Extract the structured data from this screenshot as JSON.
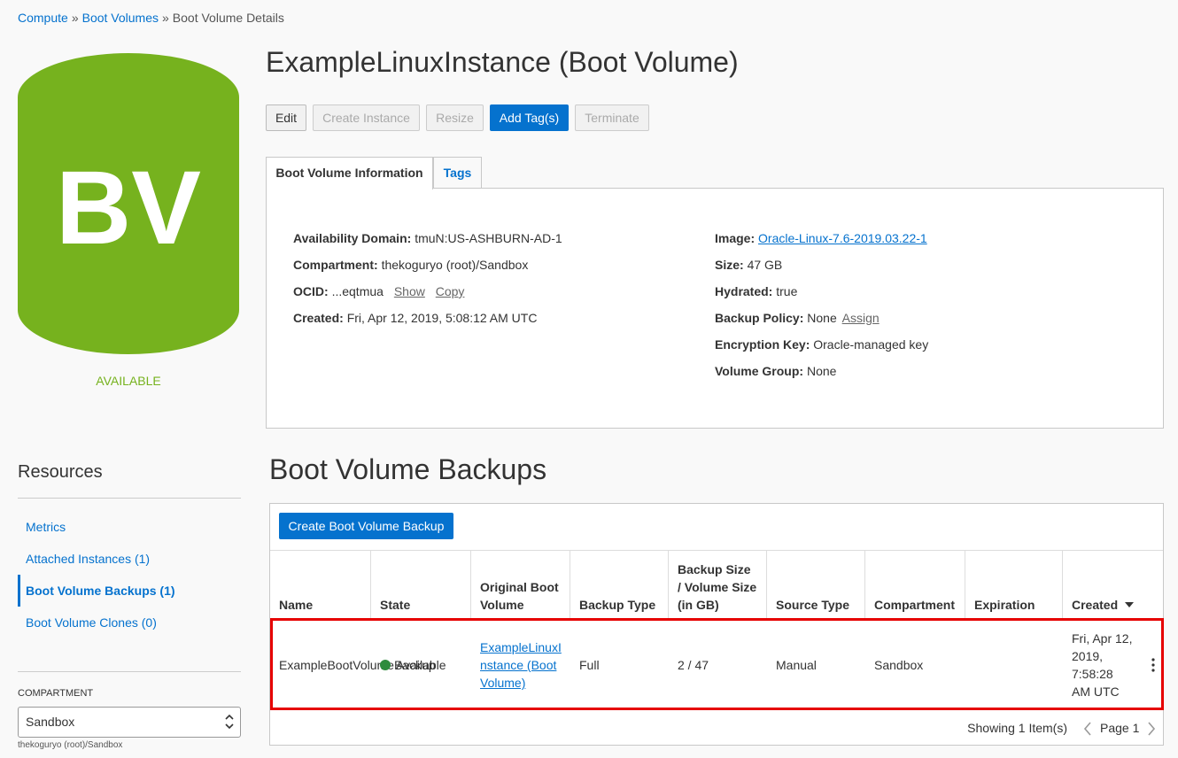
{
  "breadcrumb": {
    "compute": "Compute",
    "boot_volumes": "Boot Volumes",
    "sep": "»",
    "current": "Boot Volume Details"
  },
  "icon": {
    "letters": "BV",
    "color": "#76b21e"
  },
  "status": "AVAILABLE",
  "title": "ExampleLinuxInstance (Boot Volume)",
  "actions": {
    "edit": "Edit",
    "create_instance": "Create Instance",
    "resize": "Resize",
    "add_tags": "Add Tag(s)",
    "terminate": "Terminate"
  },
  "tabs": {
    "info": "Boot Volume Information",
    "tags": "Tags"
  },
  "info": {
    "ad_label": "Availability Domain:",
    "ad_value": "tmuN:US-ASHBURN-AD-1",
    "compartment_label": "Compartment:",
    "compartment_value": "thekoguryo (root)/Sandbox",
    "ocid_label": "OCID:",
    "ocid_value": "...eqtmua",
    "ocid_show": "Show",
    "ocid_copy": "Copy",
    "created_label": "Created:",
    "created_value": "Fri, Apr 12, 2019, 5:08:12 AM UTC",
    "image_label": "Image:",
    "image_value": "Oracle-Linux-7.6-2019.03.22-1",
    "size_label": "Size:",
    "size_value": "47 GB",
    "hydrated_label": "Hydrated:",
    "hydrated_value": "true",
    "backup_policy_label": "Backup Policy:",
    "backup_policy_value": "None",
    "backup_policy_assign": "Assign",
    "encryption_label": "Encryption Key:",
    "encryption_value": "Oracle-managed key",
    "volume_group_label": "Volume Group:",
    "volume_group_value": "None"
  },
  "resources": {
    "title": "Resources",
    "items": [
      {
        "label": "Metrics"
      },
      {
        "label": "Attached Instances (1)"
      },
      {
        "label": "Boot Volume Backups (1)"
      },
      {
        "label": "Boot Volume Clones (0)"
      }
    ],
    "compartment_label": "COMPARTMENT",
    "compartment_value": "Sandbox",
    "compartment_path": "thekoguryo (root)/Sandbox"
  },
  "backups": {
    "title": "Boot Volume Backups",
    "create_button": "Create Boot Volume Backup",
    "columns": {
      "name": "Name",
      "state": "State",
      "original": "Original Boot Volume",
      "backup_type": "Backup Type",
      "size": "Backup Size / Volume Size (in GB)",
      "source_type": "Source Type",
      "compartment": "Compartment",
      "expiration": "Expiration",
      "created": "Created"
    },
    "rows": [
      {
        "name": "ExampleBootVolumeBackup",
        "state": "Available",
        "original": "ExampleLinuxInstance (Boot Volume)",
        "backup_type": "Full",
        "size": "2 / 47",
        "source_type": "Manual",
        "compartment": "Sandbox",
        "expiration": "",
        "created": "Fri, Apr 12, 2019, 7:58:28 AM UTC"
      }
    ],
    "showing": "Showing 1 Item(s)",
    "page": "Page 1",
    "state_color": "#2e8b3d"
  }
}
